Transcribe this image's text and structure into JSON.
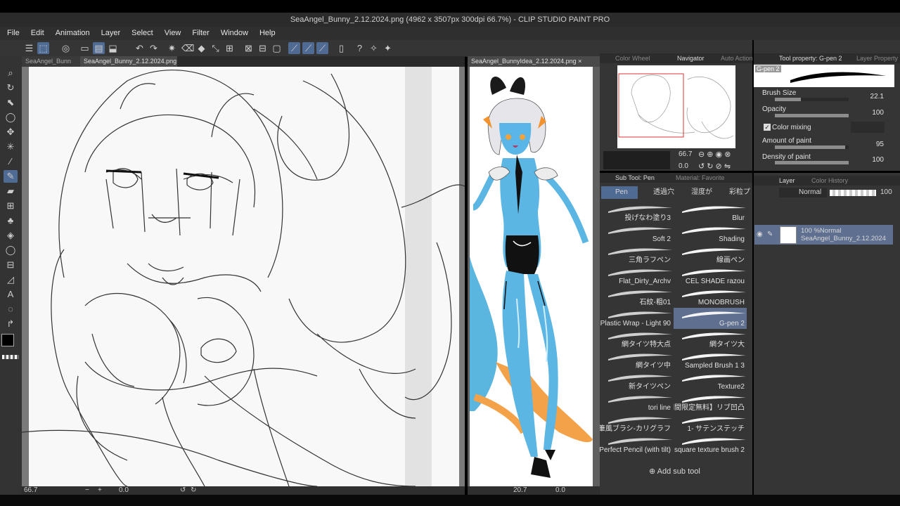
{
  "window_title": "SeaAngel_Bunny_2.12.2024.png (4962 x 3507px 300dpi 66.7%) - CLIP STUDIO PAINT PRO",
  "menu": [
    "File",
    "Edit",
    "Animation",
    "Layer",
    "Select",
    "View",
    "Filter",
    "Window",
    "Help"
  ],
  "canvas_tabs_left": [
    {
      "label": "SeaAngel_Bunn"
    },
    {
      "label": "SeaAngel_Bunny_2.12.2024.png",
      "close": "×"
    }
  ],
  "canvas_tabs_right": [
    {
      "label": "SeaAngel_BunnyIdea_2.12.2024.png",
      "close": "×"
    }
  ],
  "status_left": {
    "zoom": "66.7",
    "angle": "0.0"
  },
  "status_right": {
    "zoom": "20.7",
    "angle": "0.0"
  },
  "top_panel_tabs": {
    "color_wheel": "Color Wheel",
    "navigator": "Navigator",
    "auto_action": "Auto Action"
  },
  "navigator": {
    "zoom": "66.7",
    "angle": "0.0"
  },
  "tool_property": {
    "tabs": {
      "tool_property": "Tool property: G-pen 2",
      "layer_property": "Layer Property"
    },
    "brush_name": "G-pen 2",
    "brush_size": {
      "label": "Brush Size",
      "value": "22.1",
      "fill": 0.35
    },
    "opacity": {
      "label": "Opacity",
      "value": "100",
      "fill": 1.0
    },
    "color_mixing": {
      "label": "Color mixing",
      "checked": true
    },
    "amount_of_paint": {
      "label": "Amount of paint",
      "value": "95",
      "fill": 0.95
    },
    "density_of_paint": {
      "label": "Density of paint",
      "value": "100",
      "fill": 1.0
    }
  },
  "sub_tool": {
    "header": "Sub Tool: Pen",
    "header2": "Material: Favorite",
    "tabs": [
      "Pen",
      "透過穴",
      "湿度が",
      "彩粒プ"
    ],
    "items": [
      {
        "left": "投げなわ塗り3",
        "right": "Blur"
      },
      {
        "left": "Soft 2",
        "right": "Shading"
      },
      {
        "left": "三角ラフペン",
        "right": "線画ペン"
      },
      {
        "left": "Flat_Dirty_Archv",
        "right": "CEL SHADE razou"
      },
      {
        "left": "石紋-粗01",
        "right": "MONOBRUSH"
      },
      {
        "left": "Plastic Wrap - Light 90",
        "right": "G-pen 2"
      },
      {
        "left": "網タイツ特大点",
        "right": "網タイツ大"
      },
      {
        "left": "網タイツ中",
        "right": "Sampled Brush 1 3"
      },
      {
        "left": "新タイツペン",
        "right": "Texture2"
      },
      {
        "left": "tori line",
        "right": "【期間限定無料】リブ凹凸"
      },
      {
        "left": "万年筆風ブラシ-カリグラフ",
        "right": "1- サテンステッチ"
      },
      {
        "left": "Perfect Pencil (with tilt)",
        "right": "square texture brush 2"
      }
    ],
    "selected_index": 11,
    "add_label": "Add sub tool"
  },
  "layer_panel": {
    "tabs": {
      "layer": "Layer",
      "color_history": "Color History"
    },
    "blend_mode": "Normal",
    "opacity_value": "100",
    "layers": [
      {
        "info": "100 %Normal",
        "name": "SeaAngel_Bunny_2.12.2024"
      }
    ]
  },
  "colors": {
    "accent": "#4f6a93",
    "panel": "#353535",
    "subtool_selected": "#5e6f8f"
  }
}
